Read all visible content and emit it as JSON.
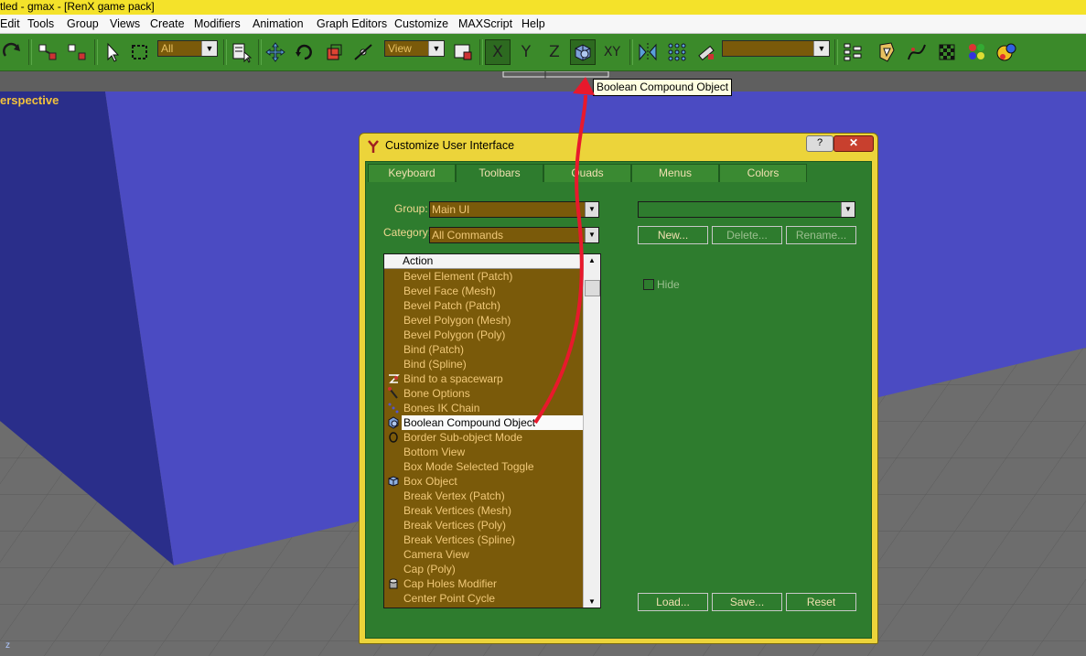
{
  "window": {
    "title": "tled - gmax - [RenX game pack]"
  },
  "menu": [
    "Edit",
    "Tools",
    "Group",
    "Views",
    "Create",
    "Modifiers",
    "Animation",
    "Graph Editors",
    "Customize",
    "MAXScript",
    "Help"
  ],
  "toolbar": {
    "selection_filter": "All",
    "reference_coord": "View",
    "axis_x": "X",
    "axis_y": "Y",
    "axis_z": "Z",
    "axis_xy": "XY",
    "named_selection": "",
    "colors": {
      "bg": "#3b8a2a"
    }
  },
  "viewport": {
    "label": "erspective",
    "corner_axis": "z"
  },
  "tooltip": {
    "text": "Boolean Compound Object"
  },
  "dialog": {
    "title": "Customize User Interface",
    "help_glyph": "?",
    "close_glyph": "✕",
    "tabs": [
      "Keyboard",
      "Toolbars",
      "Quads",
      "Menus",
      "Colors"
    ],
    "group_label": "Group:",
    "group_value": "Main UI",
    "category_label": "Category:",
    "category_value": "All Commands",
    "list_header": "Action",
    "items": [
      {
        "label": "Bevel Element (Patch)",
        "icon": ""
      },
      {
        "label": "Bevel Face (Mesh)",
        "icon": ""
      },
      {
        "label": "Bevel Patch (Patch)",
        "icon": ""
      },
      {
        "label": "Bevel Polygon (Mesh)",
        "icon": ""
      },
      {
        "label": "Bevel Polygon (Poly)",
        "icon": ""
      },
      {
        "label": "Bind (Patch)",
        "icon": ""
      },
      {
        "label": "Bind (Spline)",
        "icon": ""
      },
      {
        "label": "Bind to a spacewarp",
        "icon": "bind-spacewarp-icon"
      },
      {
        "label": "Bone Options",
        "icon": "bone-options-icon"
      },
      {
        "label": "Bones IK Chain",
        "icon": "bones-ik-icon"
      },
      {
        "label": "Boolean Compound Object",
        "icon": "boolean-icon"
      },
      {
        "label": "Border Sub-object Mode",
        "icon": "border-icon"
      },
      {
        "label": "Bottom View",
        "icon": ""
      },
      {
        "label": "Box Mode Selected Toggle",
        "icon": ""
      },
      {
        "label": "Box Object",
        "icon": "box-icon"
      },
      {
        "label": "Break Vertex (Patch)",
        "icon": ""
      },
      {
        "label": "Break Vertices (Mesh)",
        "icon": ""
      },
      {
        "label": "Break Vertices (Poly)",
        "icon": ""
      },
      {
        "label": "Break Vertices (Spline)",
        "icon": ""
      },
      {
        "label": "Camera View",
        "icon": ""
      },
      {
        "label": "Cap (Poly)",
        "icon": ""
      },
      {
        "label": "Cap Holes Modifier",
        "icon": "cap-holes-icon"
      },
      {
        "label": "Center Point Cycle",
        "icon": ""
      }
    ],
    "selected_index": 10,
    "toolbar_combo_value": "",
    "buttons": {
      "new": "New...",
      "delete": "Delete...",
      "rename": "Rename...",
      "load": "Load...",
      "save": "Save...",
      "reset": "Reset"
    },
    "hide_label": "Hide"
  }
}
